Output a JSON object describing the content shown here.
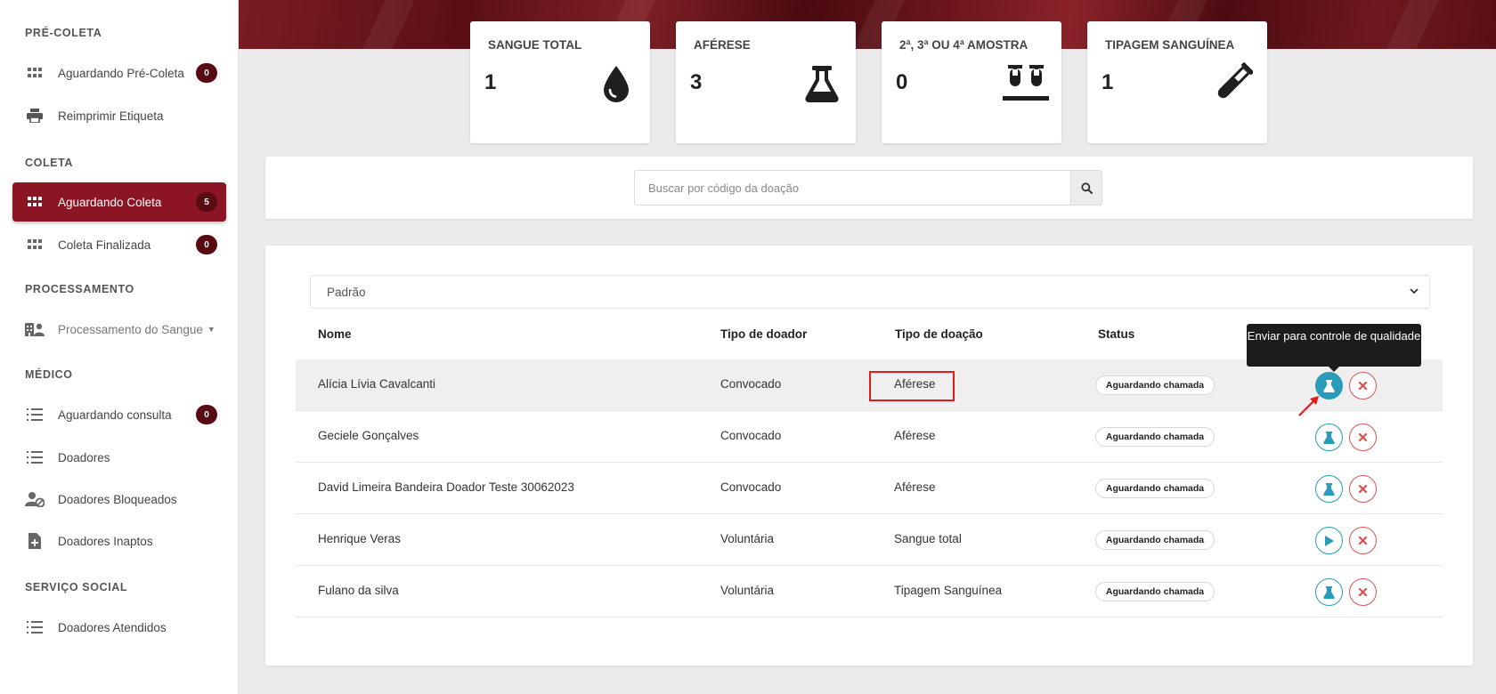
{
  "sidebar": {
    "sections": [
      {
        "title": "PRÉ-COLETA"
      },
      {
        "title": "COLETA"
      },
      {
        "title": "PROCESSAMENTO"
      },
      {
        "title": "MÉDICO"
      },
      {
        "title": "SERVIÇO SOCIAL"
      }
    ],
    "items": [
      {
        "label": "Aguardando Pré-Coleta",
        "icon": "grid-icon",
        "badge": "0"
      },
      {
        "label": "Reimprimir Etiqueta",
        "icon": "printer-icon"
      },
      {
        "label": "Aguardando Coleta",
        "icon": "grid-icon",
        "badge": "5",
        "active": true
      },
      {
        "label": "Coleta Finalizada",
        "icon": "grid-icon",
        "badge": "0"
      },
      {
        "label": "Processamento do Sangue",
        "icon": "hospital-users-icon"
      },
      {
        "label": "Aguardando consulta",
        "icon": "list-icon",
        "badge": "0"
      },
      {
        "label": "Doadores",
        "icon": "list-icon"
      },
      {
        "label": "Doadores Bloqueados",
        "icon": "user-block-icon"
      },
      {
        "label": "Doadores Inaptos",
        "icon": "file-medical-icon"
      },
      {
        "label": "Doadores Atendidos",
        "icon": "list-icon"
      }
    ]
  },
  "stats": [
    {
      "title": "SANGUE TOTAL",
      "value": "1",
      "icon": "blood-drop-icon"
    },
    {
      "title": "AFÉRESE",
      "value": "3",
      "icon": "flask-icon"
    },
    {
      "title": "2ª, 3ª OU 4ª AMOSTRA",
      "value": "0",
      "icon": "test-tubes-icon"
    },
    {
      "title": "TIPAGEM SANGUÍNEA",
      "value": "1",
      "icon": "test-tube-icon"
    }
  ],
  "search": {
    "placeholder": "Buscar por código da doação",
    "value": "",
    "icon": "search-icon"
  },
  "filter": {
    "selected": "Padrão"
  },
  "table": {
    "headers": [
      "Nome",
      "Tipo de doador",
      "Tipo de doação",
      "Status"
    ],
    "rows": [
      {
        "nome": "Alícia Lívia Cavalcanti",
        "tipo_doador": "Convocado",
        "tipo_doacao": "Aférese",
        "status": "Aguardando chamada",
        "action_icon": "flask-icon"
      },
      {
        "nome": "Geciele Gonçalves",
        "tipo_doador": "Convocado",
        "tipo_doacao": "Aférese",
        "status": "Aguardando chamada",
        "action_icon": "flask-icon"
      },
      {
        "nome": "David Limeira Bandeira Doador Teste 30062023",
        "tipo_doador": "Convocado",
        "tipo_doacao": "Aférese",
        "status": "Aguardando chamada",
        "action_icon": "flask-icon"
      },
      {
        "nome": "Henrique Veras",
        "tipo_doador": "Voluntária",
        "tipo_doacao": "Sangue total",
        "status": "Aguardando chamada",
        "action_icon": "play-icon"
      },
      {
        "nome": "Fulano da silva",
        "tipo_doador": "Voluntária",
        "tipo_doacao": "Tipagem Sanguínea",
        "status": "Aguardando chamada",
        "action_icon": "flask-icon"
      }
    ]
  },
  "tooltip": {
    "text": "Enviar para controle de qualidade"
  },
  "colors": {
    "brand": "#8b1522",
    "action": "#2a9bb8",
    "cancel": "#d9534f",
    "highlight": "#e21b1b"
  }
}
